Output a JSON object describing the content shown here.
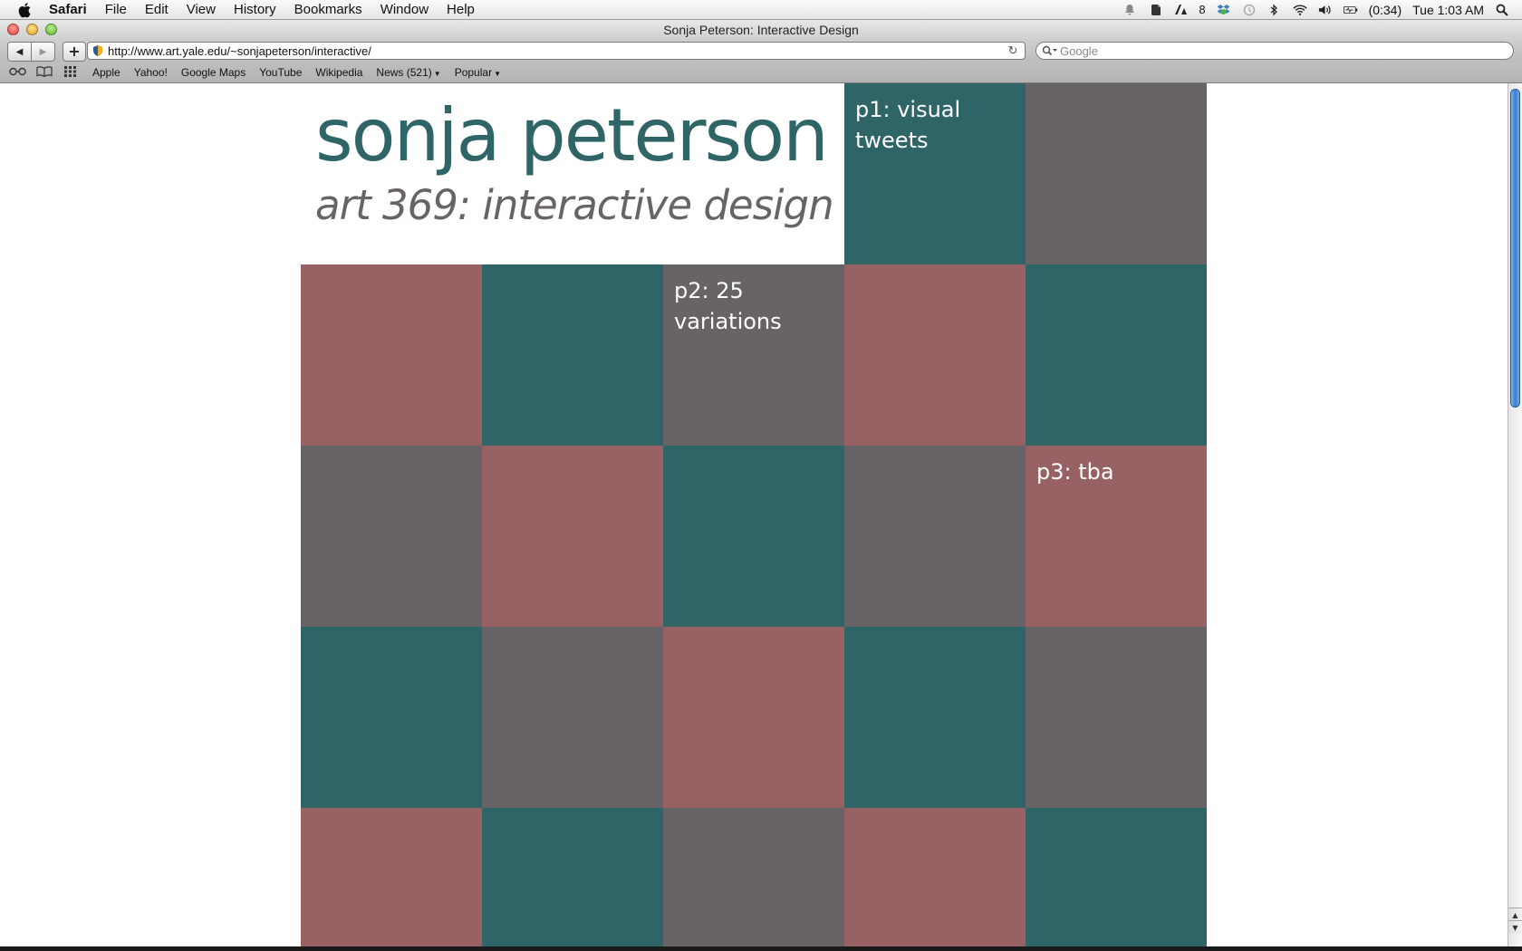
{
  "menubar": {
    "app_name": "Safari",
    "items": [
      "File",
      "Edit",
      "View",
      "History",
      "Bookmarks",
      "Window",
      "Help"
    ],
    "notification_badge": "8",
    "battery": "(0:34)",
    "clock": "Tue 1:03 AM"
  },
  "window": {
    "title": "Sonja Peterson: Interactive Design"
  },
  "toolbar": {
    "url": "http://www.art.yale.edu/~sonjapeterson/interactive/",
    "search_placeholder": "Google"
  },
  "bookmarks": [
    {
      "label": "Apple"
    },
    {
      "label": "Yahoo!"
    },
    {
      "label": "Google Maps"
    },
    {
      "label": "YouTube"
    },
    {
      "label": "Wikipedia"
    },
    {
      "label": "News (521)"
    },
    {
      "label": "Popular"
    }
  ],
  "page": {
    "title": "sonja peterson",
    "subtitle": "art 369: interactive design",
    "colors": {
      "teal": "#2f6567",
      "gray": "#686367",
      "rose": "#986164"
    },
    "projects": [
      {
        "label": "p1: visual tweets"
      },
      {
        "label": "p2: 25 variations"
      },
      {
        "label": "p3: tba"
      }
    ]
  }
}
